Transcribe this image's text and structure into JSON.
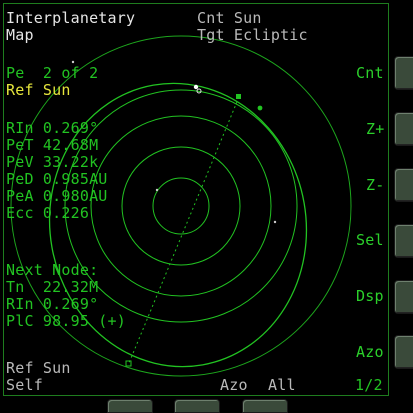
{
  "header": {
    "title_line1": "Interplanetary",
    "title_line2": "Map",
    "center": "Cnt Sun",
    "target": "Tgt Ecliptic"
  },
  "periapsis": {
    "pe_line": "Pe  2 of 2",
    "ref_line": "Ref Sun",
    "stats": [
      "RIn 0.269°",
      "PeT 42.68M",
      "PeV 33.22k",
      "PeD 0.985AU",
      "PeA 0.980AU",
      "Ecc 0.226"
    ]
  },
  "node": {
    "title": "Next Node:",
    "lines": [
      "Tn  22.32M",
      "RIn 0.269°",
      "PlC 98.95 (+)"
    ]
  },
  "footer": {
    "ref": "Ref Sun",
    "self": "Self",
    "azo": "Azo",
    "all": "All",
    "page": "1/2"
  },
  "buttons": [
    "Cnt",
    "Z+",
    "Z-",
    "Sel",
    "Dsp",
    "Azo"
  ],
  "colors": {
    "orbit": "#22c322",
    "text_primary": "#e6e6e6",
    "text_yellow": "#e6e63c",
    "text_green": "#22c322"
  }
}
